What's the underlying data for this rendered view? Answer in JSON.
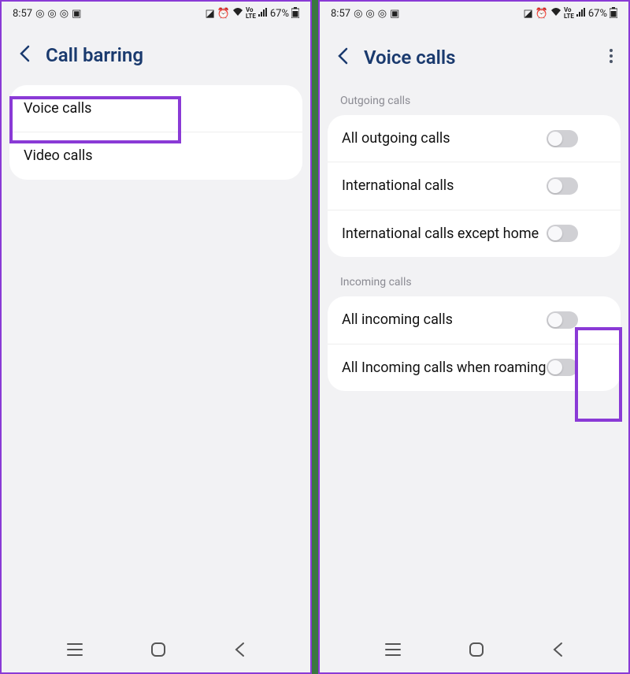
{
  "status": {
    "time": "8:57",
    "battery": "67%"
  },
  "left": {
    "title": "Call barring",
    "items": [
      {
        "label": "Voice calls"
      },
      {
        "label": "Video calls"
      }
    ]
  },
  "right": {
    "title": "Voice calls",
    "sections": {
      "outgoing": {
        "label": "Outgoing calls",
        "items": [
          {
            "label": "All outgoing calls",
            "enabled": false
          },
          {
            "label": "International calls",
            "enabled": false
          },
          {
            "label": "International calls except home",
            "enabled": false
          }
        ]
      },
      "incoming": {
        "label": "Incoming calls",
        "items": [
          {
            "label": "All incoming calls",
            "enabled": false
          },
          {
            "label": "All Incoming calls when roaming",
            "enabled": false
          }
        ]
      }
    }
  }
}
